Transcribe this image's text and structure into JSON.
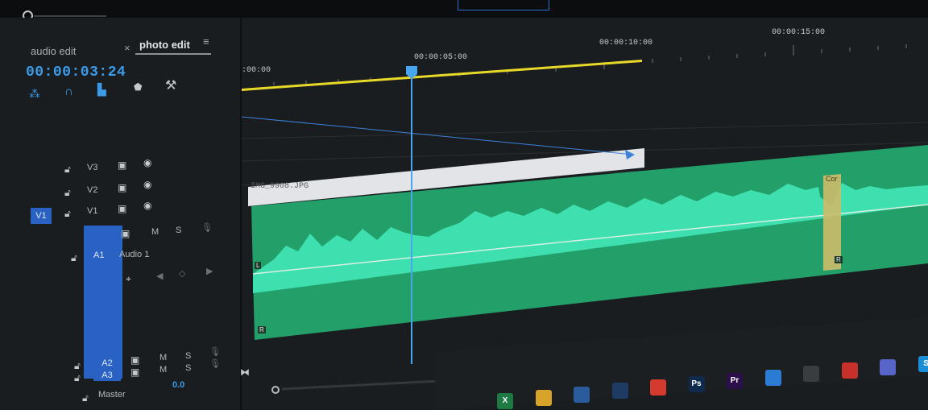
{
  "panel": {
    "tabs": [
      {
        "label": "audio edit"
      },
      {
        "label": "photo edit",
        "close": "×",
        "menu": "≡"
      }
    ],
    "timecode": "00:00:03:24",
    "toolbar_icons": [
      "snap-icon",
      "linked-selection-icon",
      "insert-icon",
      "marker-icon",
      "wrench-icon"
    ]
  },
  "ruler": {
    "labels": [
      ":00:00",
      "00:00:05:00",
      "00:00:10:00",
      "00:00:15:00"
    ]
  },
  "tracks": {
    "v3": {
      "name": "V3"
    },
    "v2": {
      "name": "V2"
    },
    "v1": {
      "name": "V1",
      "source": "V1"
    },
    "a1": {
      "name": "A1",
      "label": "Audio 1",
      "mute": "M",
      "solo": "S"
    },
    "a2": {
      "name": "A2",
      "mute": "M",
      "solo": "S"
    },
    "a3": {
      "name": "A3",
      "mute": "M",
      "solo": "S"
    },
    "master": {
      "name": "Master",
      "value": "0.0"
    }
  },
  "clips": {
    "image_clip": "IMG_9908.JPG",
    "audio_left": "L",
    "audio_right": "R",
    "audio_right_2": "R",
    "transition_label": "Cor"
  },
  "taskbar": {
    "apps": [
      {
        "name": "excel-icon",
        "label": "X",
        "color": "#1e7a43"
      },
      {
        "name": "chrome-icon",
        "label": "",
        "color": "#d8a32a"
      },
      {
        "name": "dolphin-icon",
        "label": "",
        "color": "#2a5c9c"
      },
      {
        "name": "steam-icon",
        "label": "",
        "color": "#1d3b63"
      },
      {
        "name": "creative-cloud-icon",
        "label": "",
        "color": "#d43b2e"
      },
      {
        "name": "photoshop-icon",
        "label": "Ps",
        "color": "#0f2a4d"
      },
      {
        "name": "premiere-icon",
        "label": "Pr",
        "color": "#2a0f4a"
      },
      {
        "name": "uplay-icon",
        "label": "",
        "color": "#2a7bd4"
      },
      {
        "name": "calculator-icon",
        "label": "",
        "color": "#3a3d40"
      },
      {
        "name": "flash-icon",
        "label": "",
        "color": "#c8302c"
      },
      {
        "name": "discord-icon",
        "label": "",
        "color": "#5865c8"
      },
      {
        "name": "skype-icon",
        "label": "S",
        "color": "#1a8fd6"
      }
    ]
  },
  "colors": {
    "accent_blue": "#3b9be8",
    "work_area": "#f0e028",
    "audio_clip": "#23a06a",
    "waveform": "#3fe0b0",
    "track_chip": "#2a62c4"
  }
}
